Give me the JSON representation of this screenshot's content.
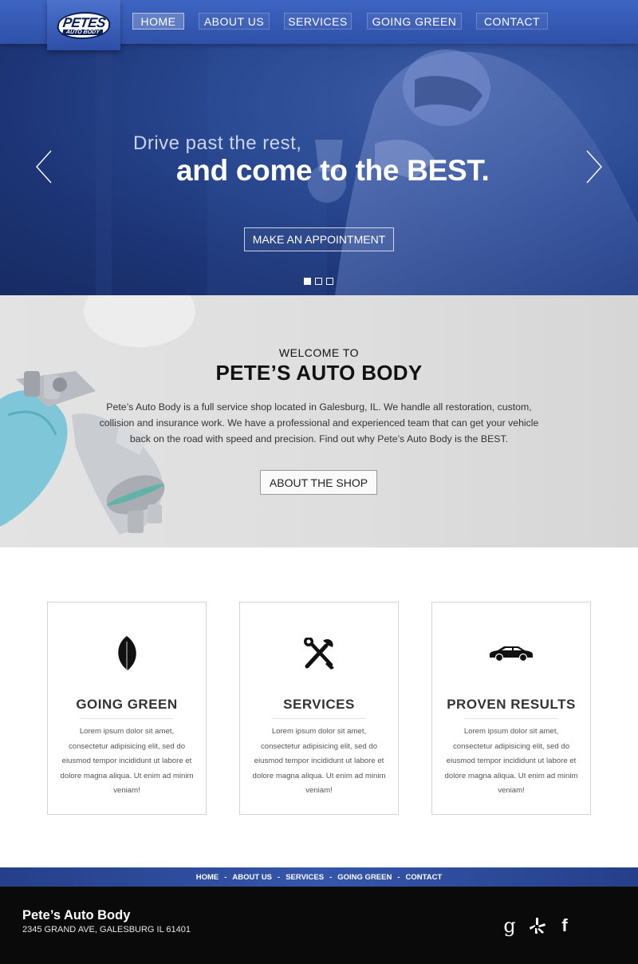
{
  "logo": {
    "main": "PETES",
    "sub": "AUTO BODY"
  },
  "nav": [
    {
      "label": "HOME",
      "active": true
    },
    {
      "label": "ABOUT US"
    },
    {
      "label": "SERVICES"
    },
    {
      "label": "GOING GREEN"
    },
    {
      "label": "CONTACT"
    }
  ],
  "hero": {
    "tagline": "Drive past the rest,",
    "headline": "and come to the BEST.",
    "cta_label": "MAKE AN APPOINTMENT",
    "slides_count": 3,
    "active_slide": 1
  },
  "welcome": {
    "pre_title": "WELCOME TO",
    "title": "PETE’S AUTO BODY",
    "body": "Pete’s Auto Body is a full service shop located in Galesburg, IL. We handle all restoration, custom, collision and insurance work. We have a professional and experienced team that can get your vehicle back on the road with speed and precision. Find out why Pete’s Auto Body is the BEST.",
    "button_label": "ABOUT THE SHOP"
  },
  "features": [
    {
      "icon": "leaf-icon",
      "title": "GOING GREEN",
      "text": "Lorem ipsum dolor sit amet, consectetur adipisicing elit, sed do eiusmod tempor incididunt ut labore et dolore magna aliqua. Ut enim ad minim veniam!"
    },
    {
      "icon": "tools-icon",
      "title": "SERVICES",
      "text": "Lorem ipsum dolor sit amet, consectetur adipisicing elit, sed do eiusmod tempor incididunt ut labore et dolore magna aliqua. Ut enim ad minim veniam!"
    },
    {
      "icon": "car-icon",
      "title": "PROVEN RESULTS",
      "text": "Lorem ipsum dolor sit amet, consectetur adipisicing elit, sed do eiusmod tempor incididunt ut labore et dolore magna aliqua. Ut enim ad minim veniam!"
    }
  ],
  "footer_nav": [
    "HOME",
    "ABOUT US",
    "SERVICES",
    "GOING GREEN",
    "CONTACT"
  ],
  "footer": {
    "name": "Pete’s Auto Body",
    "address": "2345 GRAND AVE, GALESBURG IL 61401",
    "social": {
      "google": "g",
      "facebook": "f"
    }
  },
  "colors": {
    "brand_blue": "#2f51a8",
    "dark_navy": "#172b63",
    "footer_bg": "#0a0a0a"
  }
}
